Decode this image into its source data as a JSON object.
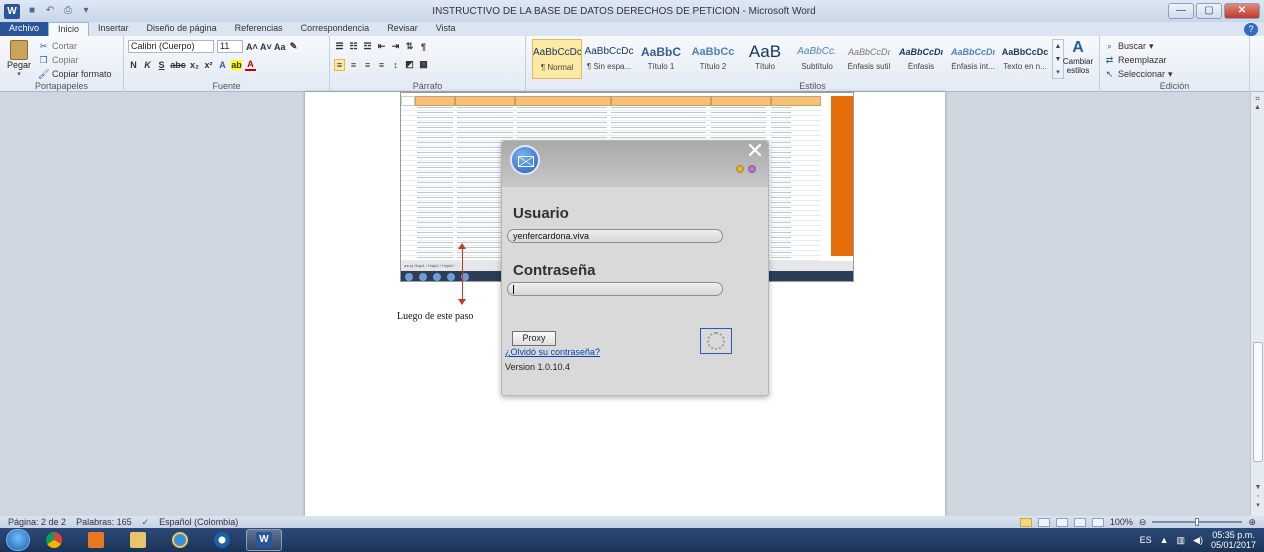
{
  "window": {
    "title": "INSTRUCTIVO DE LA BASE DE DATOS DERECHOS DE PETICION  -  Microsoft Word",
    "min": "—",
    "max": "▢",
    "close": "✕"
  },
  "tabs": [
    "Archivo",
    "Inicio",
    "Insertar",
    "Diseño de página",
    "Referencias",
    "Correspondencia",
    "Revisar",
    "Vista"
  ],
  "ribbon": {
    "clipboard": {
      "paste": "Pegar",
      "cut": "Cortar",
      "copy": "Copiar",
      "format_painter": "Copiar formato",
      "label": "Portapapeles"
    },
    "font": {
      "name": "Calibri (Cuerpo)",
      "size": "11",
      "label": "Fuente"
    },
    "paragraph": {
      "label": "Párrafo"
    },
    "styles": {
      "label": "Estilos",
      "items": [
        {
          "sample": "AaBbCcDc",
          "name": "¶ Normal"
        },
        {
          "sample": "AaBbCcDc",
          "name": "¶ Sin espa..."
        },
        {
          "sample": "AaBbC",
          "name": "Título 1"
        },
        {
          "sample": "AaBbCc",
          "name": "Título 2"
        },
        {
          "sample": "AaB",
          "name": "Título"
        },
        {
          "sample": "AaBbCc.",
          "name": "Subtítulo"
        },
        {
          "sample": "AaBbCcDı",
          "name": "Énfasis sutil"
        },
        {
          "sample": "AaBbCcDı",
          "name": "Énfasis"
        },
        {
          "sample": "AaBbCcDı",
          "name": "Énfasis int..."
        },
        {
          "sample": "AaBbCcDc",
          "name": "Texto en n..."
        }
      ],
      "change": "Cambiar estilos"
    },
    "editing": {
      "find": "Buscar",
      "replace": "Reemplazar",
      "select": "Seleccionar",
      "label": "Edición"
    }
  },
  "login": {
    "user_label": "Usuario",
    "user_value": "yenfercardona.viva",
    "password_label": "Contraseña",
    "proxy": "Proxy",
    "forgot": "¿Olvidó su contraseña?",
    "version": "Version  1.0.10.4"
  },
  "annotation": {
    "note": "Luego de este paso"
  },
  "status": {
    "page": "Página: 2 de 2",
    "words": "Palabras: 165",
    "language": "Español (Colombia)",
    "zoom": "100%"
  },
  "tray": {
    "lang": "ES",
    "time": "05:35 p.m.",
    "date": "05/01/2017"
  },
  "colors": {
    "word_blue": "#2a5699",
    "sheet_orange": "#e46c0a",
    "link_blue": "#0645ad"
  }
}
